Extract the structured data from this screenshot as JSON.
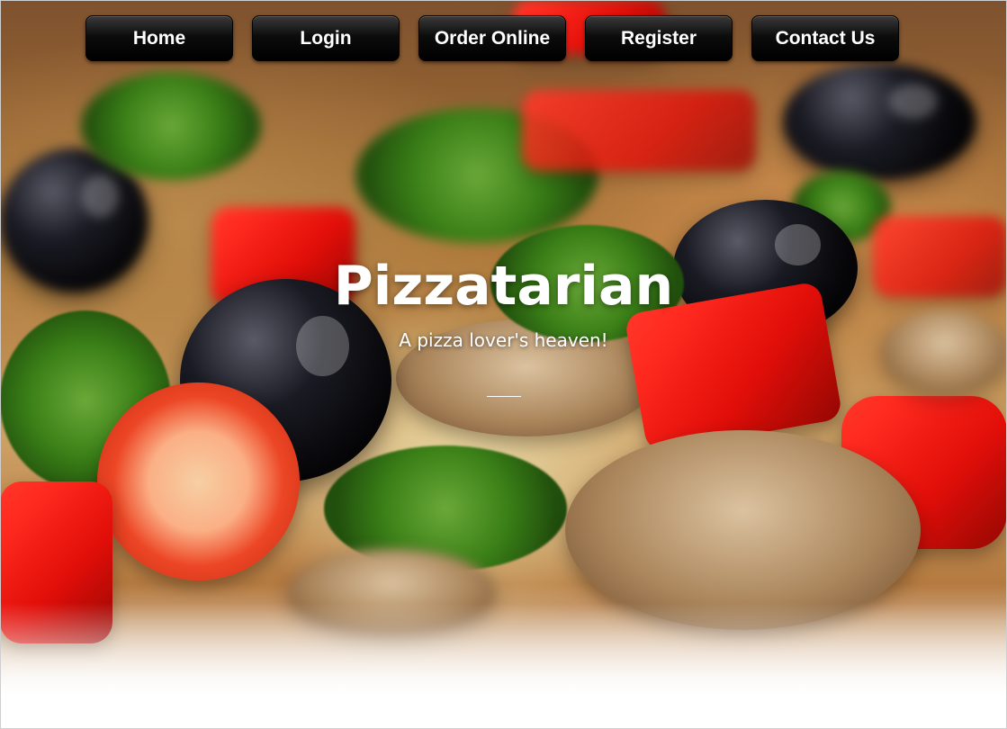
{
  "nav": {
    "items": [
      {
        "label": "Home"
      },
      {
        "label": "Login"
      },
      {
        "label": "Order Online"
      },
      {
        "label": "Register"
      },
      {
        "label": "Contact Us"
      }
    ]
  },
  "hero": {
    "title": "Pizzatarian",
    "tagline": "A pizza lover's heaven!"
  },
  "colors": {
    "nav_background": "#000000",
    "nav_text": "#ffffff",
    "title_text": "#ffffff"
  }
}
